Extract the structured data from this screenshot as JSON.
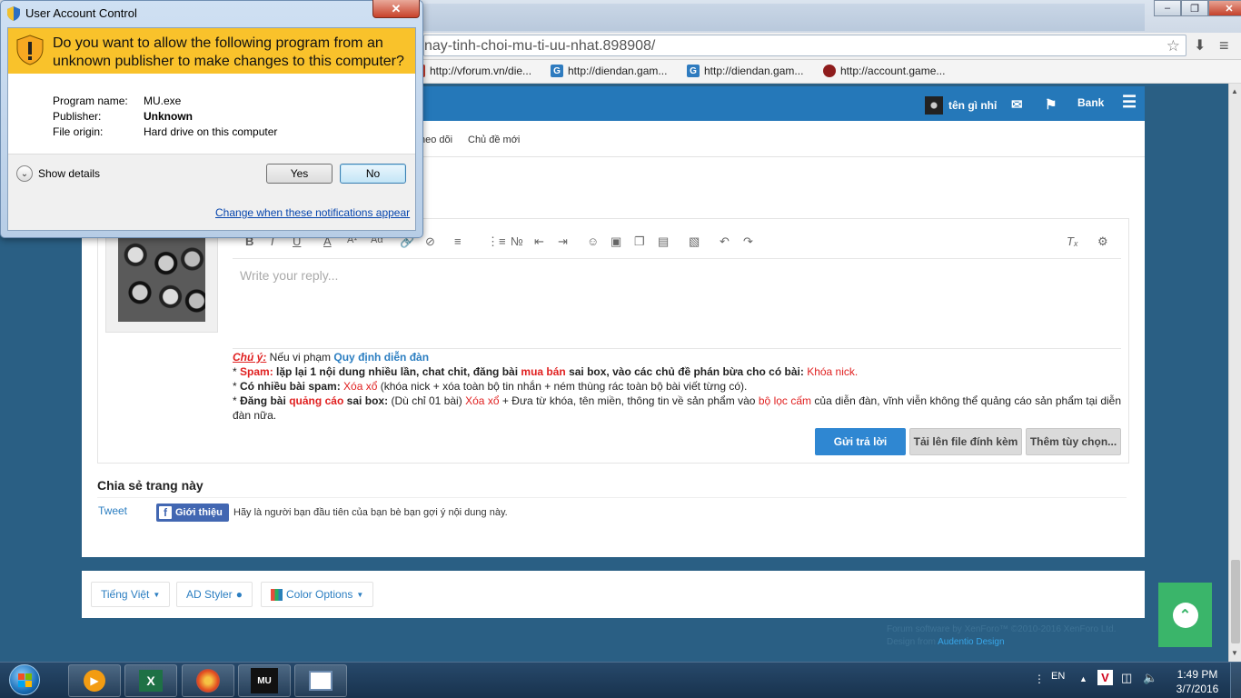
{
  "browser": {
    "url_fragment": "nay-tinh-choi-mu-ti-uu-nhat.898908/",
    "bookmarks": [
      {
        "label": "http://vforum.vn/die..."
      },
      {
        "label": "http://diendan.gam..."
      },
      {
        "label": "http://diendan.gam..."
      },
      {
        "label": "http://account.game..."
      }
    ]
  },
  "site": {
    "nav": {
      "username": "tên gì nhỉ",
      "bank_label": "Bank"
    },
    "subnav": {
      "item1": "heo dõi",
      "item2": "Chủ đề mới"
    },
    "editor": {
      "placeholder": "Write your reply..."
    },
    "rules": {
      "line1_label": "Chú ý:",
      "line1_text": " Nếu vi phạm ",
      "line1_link": "Quy định diễn đàn",
      "line2_star": "* ",
      "line2_label": "Spam:",
      "line2_text_a": " lặp lại 1 nội dung nhiều lần, chat chit, đăng bài ",
      "line2_red": "mua bán",
      "line2_text_b": " sai box, vào các chủ đề phán bừa cho có bài: ",
      "line2_result": "Khóa nick.",
      "line3_star": "* ",
      "line3_label": "Có nhiều bài spam:",
      "line3_red": " Xóa xổ",
      "line3_text": " (khóa nick + xóa toàn bộ tin nhắn + ném thùng rác toàn bộ bài viết từng có).",
      "line4_star": "* ",
      "line4_label_a": "Đăng bài ",
      "line4_red_a": "quảng cáo",
      "line4_label_b": " sai box:",
      "line4_text_a": " (Dù chỉ 01 bài) ",
      "line4_red_b": "Xóa xổ",
      "line4_text_b": " + Đưa từ khóa, tên miền, thông tin về sản phẩm vào ",
      "line4_red_c": "bộ lọc cấm",
      "line4_text_c": " của diễn đàn, vĩnh viễn không thể quảng cáo sản phẩm tại diễn đàn nữa."
    },
    "buttons": {
      "submit": "Gửi trả lời",
      "upload": "Tải lên file đính kèm",
      "more": "Thêm tùy chọn..."
    },
    "share": {
      "title": "Chia sẻ trang này",
      "tweet": "Tweet",
      "fb_button": "Giới thiệu",
      "fb_text": "Hãy là người bạn đầu tiên của bạn bè bạn gợi ý nội dung này."
    },
    "footer": {
      "language": "Tiếng Việt",
      "styler": "AD Styler",
      "color_options": "Color Options",
      "copyright": "Forum software by XenForo™ ©2010-2016 XenForo Ltd.",
      "design_prefix": "Design from ",
      "design_link": "Audentio Design"
    }
  },
  "uac": {
    "title": "User Account Control",
    "question": "Do you want to allow the following program from an unknown publisher to make changes to this computer?",
    "program_name_label": "Program name:",
    "program_name_value": "MU.exe",
    "publisher_label": "Publisher:",
    "publisher_value": "Unknown",
    "origin_label": "File origin:",
    "origin_value": "Hard drive on this computer",
    "show_details": "Show details",
    "yes": "Yes",
    "no": "No",
    "change_link": "Change when these notifications appear"
  },
  "taskbar": {
    "lang": "EN",
    "time": "1:49 PM",
    "date": "3/7/2016"
  },
  "colors": {
    "page_bg": "#2a5f84",
    "nav_blue": "#2578b9",
    "uac_yellow": "#f9c22b",
    "to_top_green": "#3ab56a"
  }
}
